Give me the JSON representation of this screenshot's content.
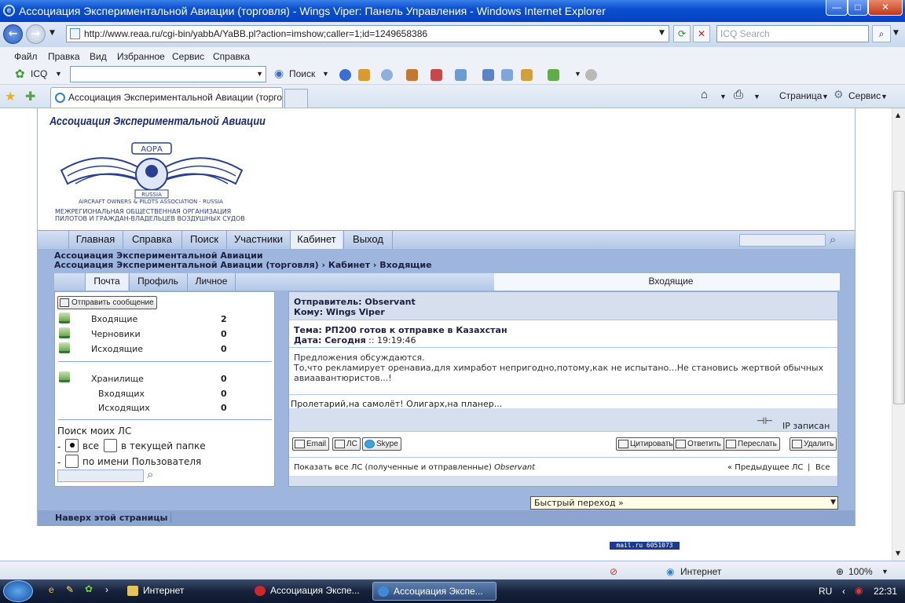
{
  "window": {
    "title": "Ассоциация Экспериментальной Авиации (торговля) - Wings Viper: Панель Управления - Windows Internet Explorer",
    "minimize": "—",
    "maximize": "□",
    "close": "✕"
  },
  "address": {
    "url": "http://www.reaa.ru/cgi-bin/yabbA/YaBB.pl?action=imshow;caller=1;id=1249658386",
    "search_placeholder": "ICQ Search"
  },
  "menu": {
    "file": "Файл",
    "edit": "Правка",
    "view": "Вид",
    "favorites": "Избранное",
    "tools": "Сервис",
    "help": "Справка"
  },
  "icq": {
    "label": "ICQ",
    "search": "Поиск"
  },
  "tabs": {
    "active": "Ассоциация Экспериментальной Авиации (торговл...",
    "home": "⌂",
    "print": "⎙",
    "page": "Страница",
    "tools": "Сервис"
  },
  "site": {
    "name": "Ассоциация Экспериментальной Авиации",
    "logo_line1": "AIRCRAFT OWNERS & PILOTS ASSOCIATION - RUSSIA",
    "logo_line2": "Межрегиональная общественная организация",
    "logo_line3": "пилотов и граждан-владельцев воздушных судов",
    "logo_badge": "АОРА",
    "logo_russia": "RUSSIA"
  },
  "mainnav": [
    "Главная",
    "Справка",
    "Поиск",
    "Участники",
    "Кабинет",
    "Выход"
  ],
  "breadcrumb": {
    "line1": "Ассоциация Экспериментальной Авиации",
    "line2": "Ассоциация Экспериментальной Авиации (торговля) › Кабинет › Входящие"
  },
  "subnav": [
    "Почта",
    "Профиль",
    "Личное"
  ],
  "subnav_title": "Входящие",
  "left": {
    "send_btn": "Отправить сообщение",
    "folders": [
      {
        "label": "Входящие",
        "count": "2"
      },
      {
        "label": "Черновики",
        "count": "0"
      },
      {
        "label": "Исходящие",
        "count": "0"
      }
    ],
    "storage": {
      "label": "Хранилище",
      "count": "0"
    },
    "storage_in": {
      "label": "Входящих",
      "count": "0"
    },
    "storage_out": {
      "label": "Исходящих",
      "count": "0"
    },
    "search_title": "Поиск моих ЛС",
    "opt_all": "все",
    "opt_current": "в текущей папке",
    "opt_user": "по имени Пользователя",
    "dash": "-"
  },
  "message": {
    "from": "Отправитель: Observant",
    "to": "Кому: Wings Viper",
    "subject": "Тема: РП200 готов к отправке в Казахстан",
    "date_label": "Дата: Сегодня",
    "date_time": ":: 19:19:46",
    "body_line1": "Предложения обсуждаются.",
    "body_line2": "То,что рекламирует оренавиа,для химработ непригодно,потому,как не испытано...Не становись жертвой обычных",
    "body_line3": "авиаавантюристов...!",
    "signature": "Пролетарий,на самолёт! Олигарх,на планер...",
    "ip": "IP записан",
    "btn_email": "Email",
    "btn_pm": "ЛС",
    "btn_skype": "Skype",
    "btn_quote": "Цитировать",
    "btn_reply": "Ответить",
    "btn_forward": "Переслать",
    "btn_delete": "Удалить",
    "show_all": "Показать все ЛС (полученные и отправленные)",
    "show_all_user": "Observant",
    "prev": "« Предыдущее ЛС",
    "sep": "|",
    "all": "Все"
  },
  "quick_jump": "Быстрый переход »",
  "to_top": "Наверх этой страницы",
  "counter": "mail.ru  6051073",
  "status": {
    "zone": "Интернет",
    "zoom": "100%"
  },
  "taskbar": {
    "task1": "Интернет",
    "task2": "Ассоциация Экспе...",
    "task3": "Ассоциация Экспе...",
    "lang": "RU",
    "time": "22:31"
  }
}
